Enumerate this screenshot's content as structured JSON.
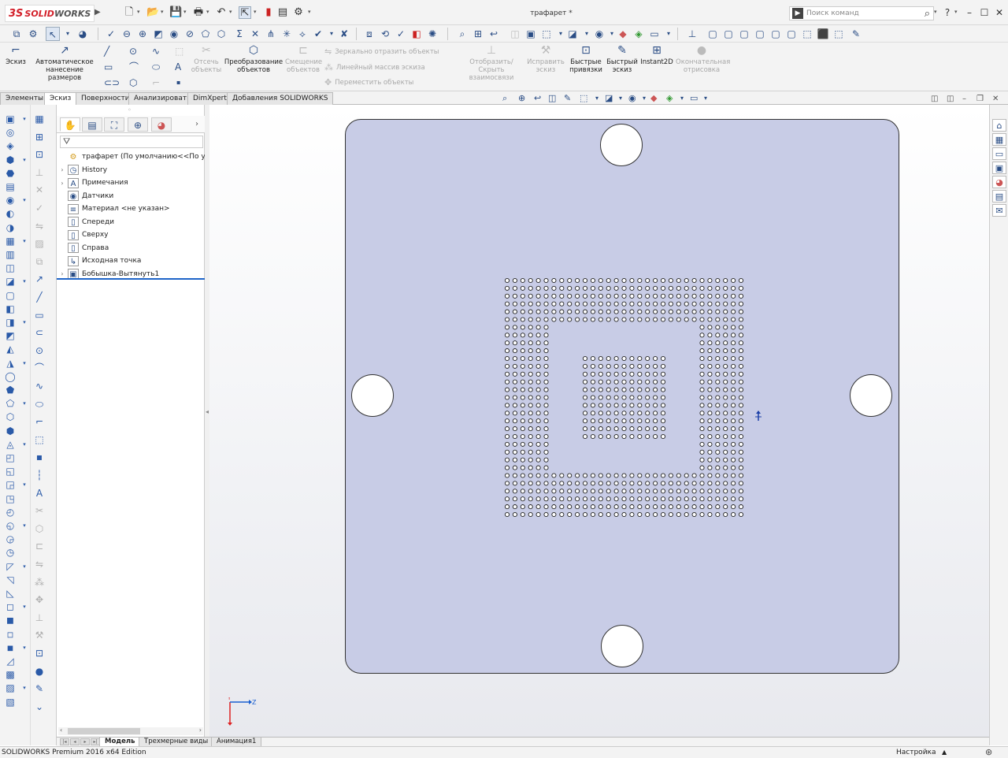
{
  "app": {
    "brand_mark": "3S",
    "brand_solid": "SOLID",
    "brand_works": "WORKS",
    "document_title": "трафарет *"
  },
  "search": {
    "placeholder": "Поиск команд"
  },
  "window_buttons": {
    "help": "?",
    "minimize": "–",
    "maximize": "☐",
    "close": "✕"
  },
  "ribbon": {
    "sketch": "Эскиз",
    "smart_dim": "Автоматическое нанесение размеров",
    "trim": "Отсечь объекты",
    "convert": "Преобразование объектов",
    "offset": "Смещение объектов",
    "mirror": "Зеркально отразить объекты",
    "linear_pattern": "Линейный массив эскиза",
    "move": "Переместить объекты",
    "display_relations": "Отобразить/Скрыть взаимосвязи",
    "repair": "Исправить эскиз",
    "quick_snaps": "Быстрые привязки",
    "rapid_sketch": "Быстрый эскиз",
    "instant2d": "Instant2D",
    "shaded_sketch": "Окончательная отрисовка"
  },
  "tabs": [
    "Элементы",
    "Эскиз",
    "Поверхности",
    "Анализировать",
    "DimXpert",
    "Добавления SOLIDWORKS"
  ],
  "active_tab": "Эскиз",
  "feature_tree": {
    "filter_icon": "filter-icon",
    "nodes": [
      {
        "label": "трафарет  (По умолчанию<<По умолча",
        "icon": "part-icon",
        "expand": ""
      },
      {
        "label": "History",
        "icon": "history-icon",
        "expand": "›"
      },
      {
        "label": "Примечания",
        "icon": "annotations-icon",
        "expand": "›"
      },
      {
        "label": "Датчики",
        "icon": "sensors-icon",
        "expand": ""
      },
      {
        "label": "Материал <не указан>",
        "icon": "material-icon",
        "expand": ""
      },
      {
        "label": "Спереди",
        "icon": "plane-icon",
        "expand": ""
      },
      {
        "label": "Сверху",
        "icon": "plane-icon",
        "expand": ""
      },
      {
        "label": "Справа",
        "icon": "plane-icon",
        "expand": ""
      },
      {
        "label": "Исходная точка",
        "icon": "origin-icon",
        "expand": ""
      },
      {
        "label": "Бобышка-Вытянуть1",
        "icon": "extrude-icon",
        "expand": "›"
      }
    ]
  },
  "model_tabs": [
    "Модель",
    "Трехмерные виды",
    "Анимация1"
  ],
  "active_model_tab": "Модель",
  "status": {
    "left": "SOLIDWORKS Premium 2016 x64 Edition",
    "right": "Настройка",
    "up": "▲"
  },
  "triad": {
    "x": "Z",
    "y": "Y"
  },
  "colors": {
    "plate_fill": "#c8cce6",
    "brand_red": "#d3202a",
    "accent_blue": "#1e64c8"
  }
}
